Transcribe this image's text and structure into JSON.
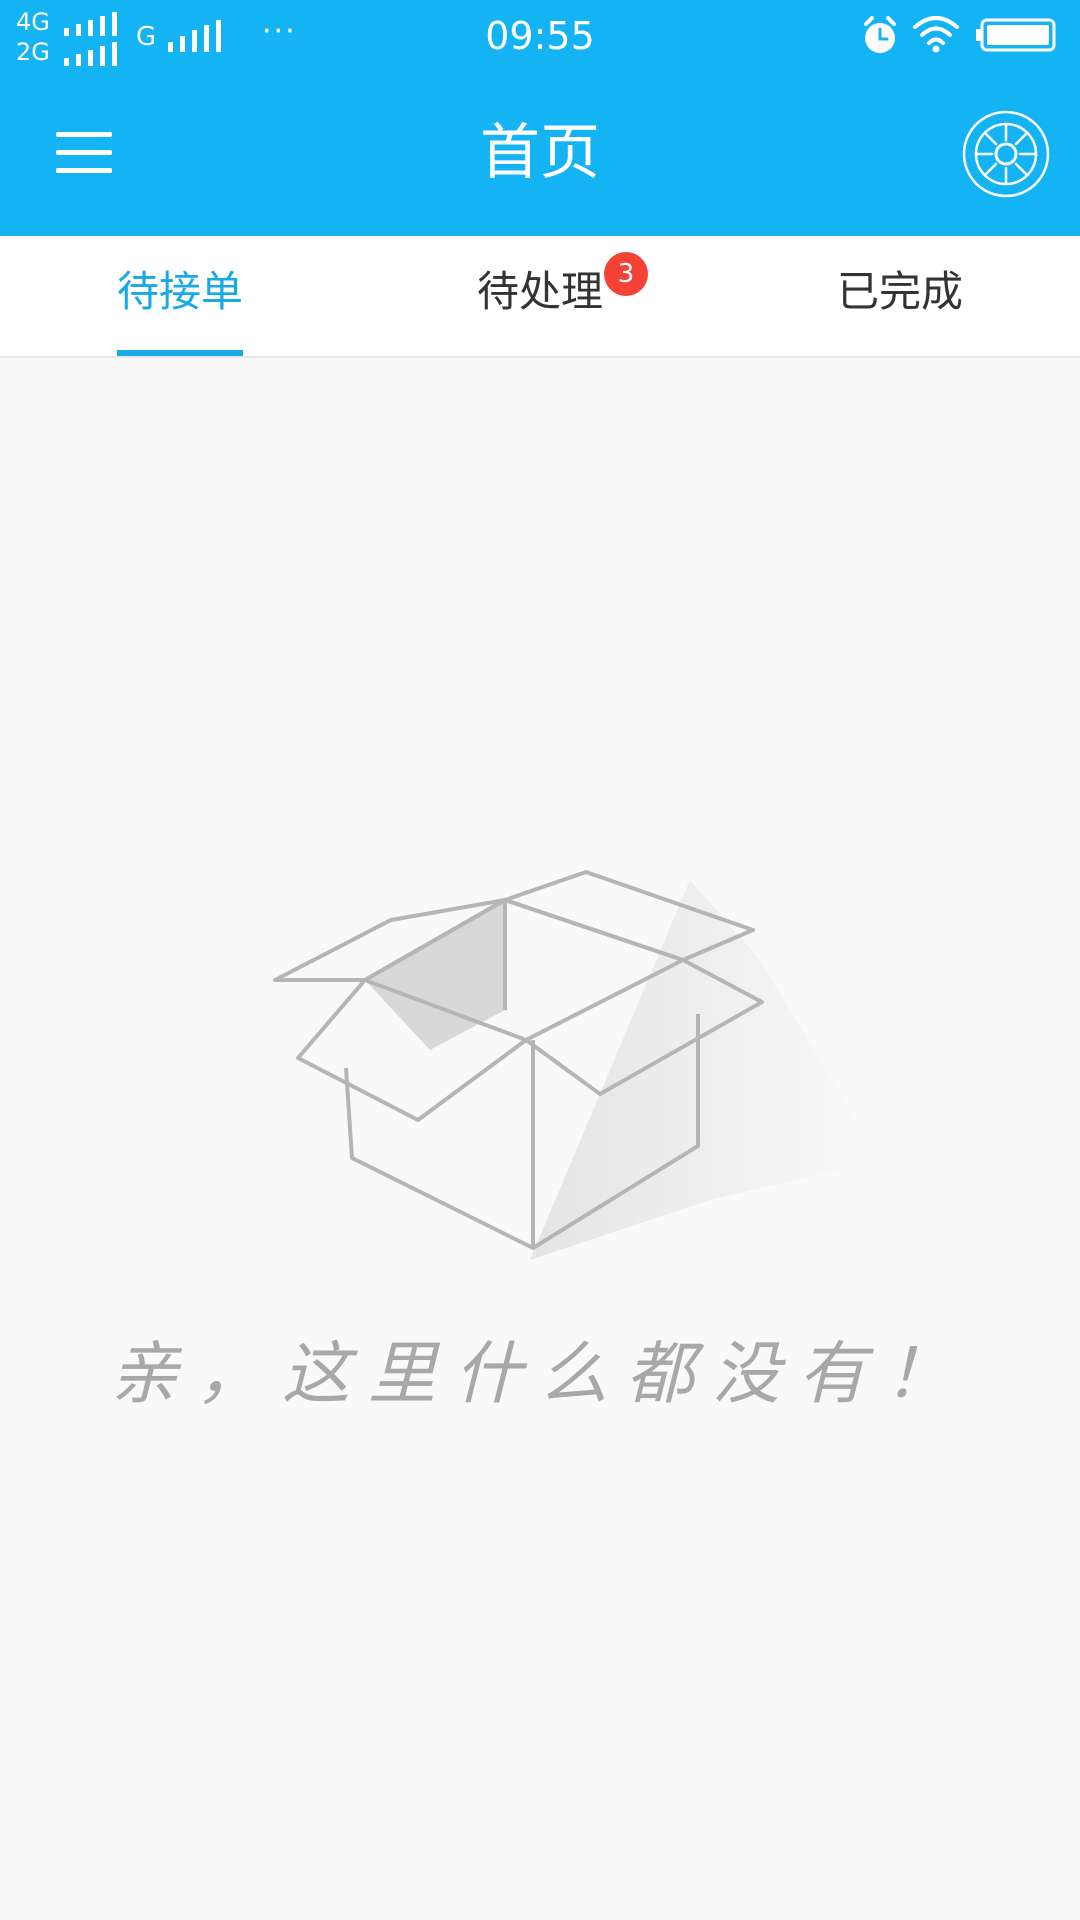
{
  "status_bar": {
    "network1": "4G",
    "network2": "2G",
    "network3": "G",
    "more": "···",
    "time": "09:55",
    "icons": [
      "alarm-icon",
      "wifi-icon",
      "battery-icon"
    ]
  },
  "header": {
    "title": "首页",
    "left_icon": "menu-icon",
    "right_icon": "settings-icon"
  },
  "tabs": [
    {
      "label": "待接单",
      "active": true
    },
    {
      "label": "待处理",
      "badge": "3"
    },
    {
      "label": "已完成"
    }
  ],
  "empty_state": {
    "icon": "empty-box-icon",
    "message": "亲，这里什么都没有！"
  },
  "colors": {
    "header_bg": "#14b4f4",
    "tab_active": "#18a9e6",
    "tab_inactive": "#333333",
    "badge_bg": "#f44336",
    "page_bg": "#f9f9f9",
    "empty_text": "#a8a8a8"
  }
}
